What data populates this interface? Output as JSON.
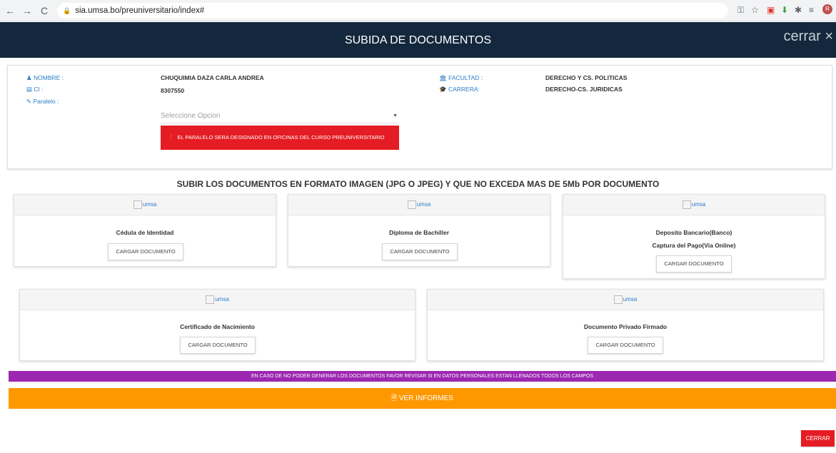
{
  "browser": {
    "url": "sia.umsa.bo/preuniversitario/index#",
    "back_icon": "←",
    "forward_icon": "→",
    "reload_icon": "C"
  },
  "modal": {
    "title": "SUBIDA DE DOCUMENTOS",
    "close_text": "cerrar ×"
  },
  "student": {
    "nombre_label": "NOMBRE :",
    "nombre_value": "CHUQUIMIA DAZA CARLA ANDREA",
    "ci_label": "CI :",
    "ci_value": "8307550",
    "paralelo_label": "Paralelo :",
    "facultad_label": "FACULTAD :",
    "facultad_value": "DERECHO Y CS. POLITICAS",
    "carrera_label": "CARRERA:",
    "carrera_value": "DERECHO-CS. JURIDICAS",
    "select_placeholder": "Seleccione Opcion",
    "alert_text": "EL PARALELO SERA DESIGNADO EN OFICINAS DEL CURSO PREUNIVERSITARIO"
  },
  "upload": {
    "title": "SUBIR LOS DOCUMENTOS EN FORMATO IMAGEN (JPG O JPEG) Y QUE NO EXCEDA MAS DE 5Mb POR DOCUMENTO",
    "image_alt": "umsa",
    "button_label": "CARGAR DOCUMENTO",
    "docs": [
      {
        "name": "Cédula de Identidad"
      },
      {
        "name": "Diploma de Bachiller"
      },
      {
        "name": "Deposito Bancario(Banco)",
        "name2": "Captura del Pago(Via Online)"
      },
      {
        "name": "Certificado de Nacimiento"
      },
      {
        "name": "Documento Privado Firmado"
      }
    ]
  },
  "notice": "EN CASO DE NO PODER GENERAR LOS DOCUMENTOS FAVOR REVISAR SI EN DATOS PERSONALES ESTAN LLENADOS TODOS LOS CAMPOS",
  "report_button": "VER INFORMES",
  "close_button": "CERRAR",
  "colors": {
    "header": "#13283d",
    "alert": "#e51c23",
    "notice": "#9c27b0",
    "report": "#ff9800"
  }
}
